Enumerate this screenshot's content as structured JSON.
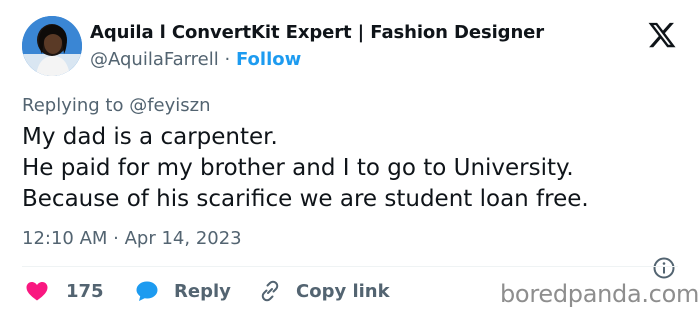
{
  "author": {
    "name": "Aquila l ConvertKit Expert | Fashion Designer",
    "handle": "@AquilaFarrell",
    "separator": "·",
    "follow_label": "Follow"
  },
  "reply_context": {
    "prefix": "Replying to",
    "mention": "@feyiszn"
  },
  "tweet": {
    "lines": [
      "My dad is a carpenter.",
      "He paid for my brother and I to go to University.",
      "Because of his scarifice we are student loan free."
    ],
    "timestamp": "12:10 AM · Apr 14, 2023"
  },
  "actions": {
    "like_count": "175",
    "reply_label": "Reply",
    "copy_label": "Copy link"
  },
  "watermark": "boredpanda.com",
  "icons": {
    "brand": "x-logo-icon",
    "info": "info-icon",
    "like": "heart-icon",
    "reply": "speech-bubble-icon",
    "copy": "link-icon"
  },
  "colors": {
    "text": "#0f1419",
    "secondary": "#536471",
    "accent": "#1d9bf0",
    "like": "#f91880",
    "divider": "#eff3f4"
  }
}
